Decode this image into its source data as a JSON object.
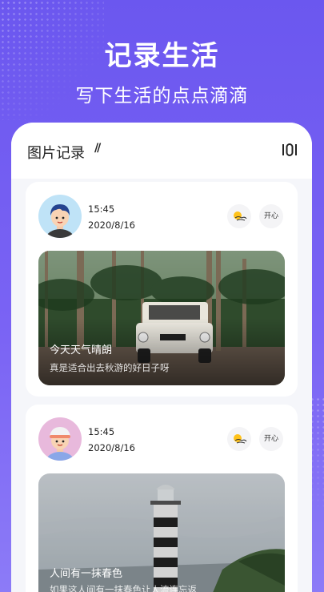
{
  "hero": {
    "title": "记录生活",
    "subtitle": "写下生活的点点滴滴"
  },
  "header": {
    "title": "图片记录",
    "title_mark": "//",
    "menu_icon": "list-toggle-icon"
  },
  "entries": [
    {
      "time": "15:45",
      "date": "2020/8/16",
      "weather_icon": "sunny-cloud-icon",
      "mood": "开心",
      "caption_title": "今天天气晴朗",
      "caption_text": "真是适合出去秋游的好日子呀",
      "photo": "jeep-in-palm-forest"
    },
    {
      "time": "15:45",
      "date": "2020/8/16",
      "weather_icon": "sunny-cloud-icon",
      "mood": "开心",
      "caption_title": "人间有一抹春色",
      "caption_text": "如果这人间有一抹春色让人流连忘返",
      "photo": "lighthouse-on-coast"
    }
  ],
  "colors": {
    "background": "#6b57ef",
    "accent_sun": "#ffc21a"
  }
}
